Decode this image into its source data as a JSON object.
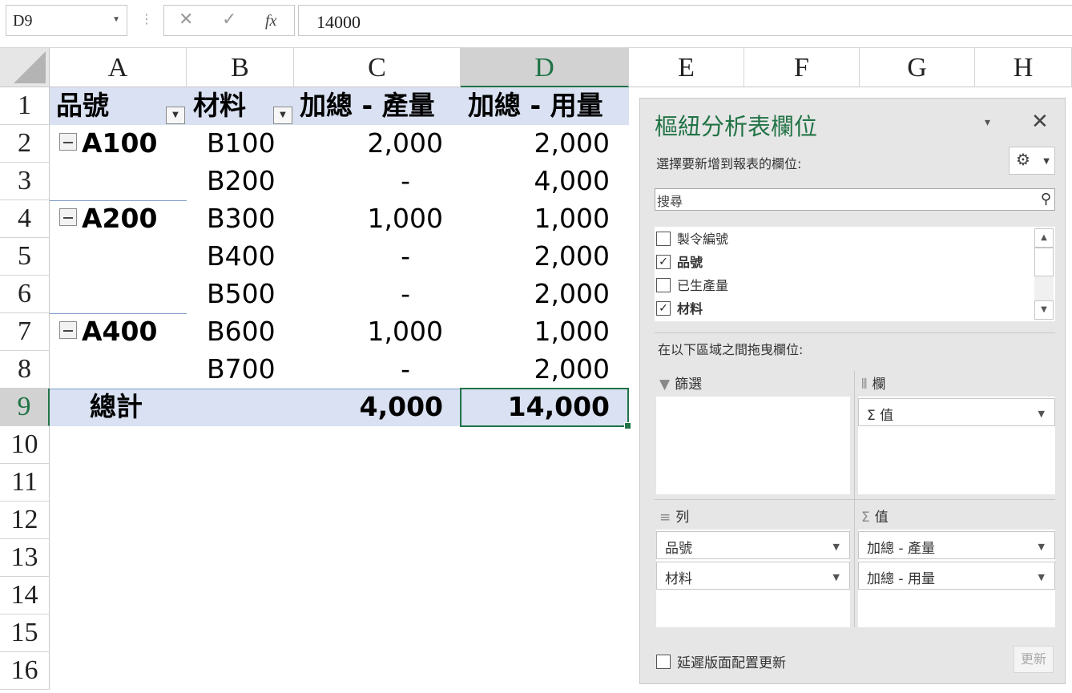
{
  "formula_bar": {
    "name_box": "D9",
    "cancel_icon": "✕",
    "enter_icon": "✓",
    "fx_label": "fx",
    "value": "14000"
  },
  "columns": [
    "A",
    "B",
    "C",
    "D",
    "E",
    "F",
    "G",
    "H"
  ],
  "rows": [
    "1",
    "2",
    "3",
    "4",
    "5",
    "6",
    "7",
    "8",
    "9",
    "10",
    "11",
    "12",
    "13",
    "14",
    "15",
    "16"
  ],
  "pivot": {
    "headers": {
      "product": "品號",
      "material": "材料",
      "sum_output": "加總 - 產量",
      "sum_usage": "加總 - 用量"
    },
    "groups": [
      {
        "product": "A100"
      },
      {
        "product": "A200"
      },
      {
        "product": "A400"
      }
    ],
    "lines": [
      {
        "material": "B100",
        "output": "2,000",
        "usage": "2,000"
      },
      {
        "material": "B200",
        "output": "-",
        "usage": "4,000"
      },
      {
        "material": "B300",
        "output": "1,000",
        "usage": "1,000"
      },
      {
        "material": "B400",
        "output": "-",
        "usage": "2,000"
      },
      {
        "material": "B500",
        "output": "-",
        "usage": "2,000"
      },
      {
        "material": "B600",
        "output": "1,000",
        "usage": "1,000"
      },
      {
        "material": "B700",
        "output": "-",
        "usage": "2,000"
      }
    ],
    "total": {
      "label": "總計",
      "output": "4,000",
      "usage": "14,000"
    }
  },
  "pane": {
    "title": "樞紐分析表欄位",
    "menu_icon": "▾",
    "close_icon": "✕",
    "choose_label": "選擇要新增到報表的欄位:",
    "gear_icon": "⚙",
    "search_placeholder": "搜尋",
    "search_icon": "⚲",
    "fields": [
      {
        "label": "製令編號",
        "checked": false
      },
      {
        "label": "品號",
        "checked": true
      },
      {
        "label": "已生產量",
        "checked": false
      },
      {
        "label": "材料",
        "checked": true
      }
    ],
    "drag_label": "在以下區域之間拖曳欄位:",
    "areas": {
      "filters": {
        "icon": "▼",
        "label": "篩選"
      },
      "columns": {
        "icon": "⦀",
        "label": "欄",
        "chips": [
          "Σ 值"
        ]
      },
      "rows": {
        "icon": "≡",
        "label": "列",
        "chips": [
          "品號",
          "材料"
        ]
      },
      "values": {
        "icon": "Σ",
        "label": "值",
        "chips": [
          "加總 - 產量",
          "加總 - 用量"
        ]
      }
    },
    "defer_label": "延遲版面配置更新",
    "update_label": "更新"
  },
  "colors": {
    "accent": "#217346",
    "pivot_band": "#d9e1f2"
  }
}
